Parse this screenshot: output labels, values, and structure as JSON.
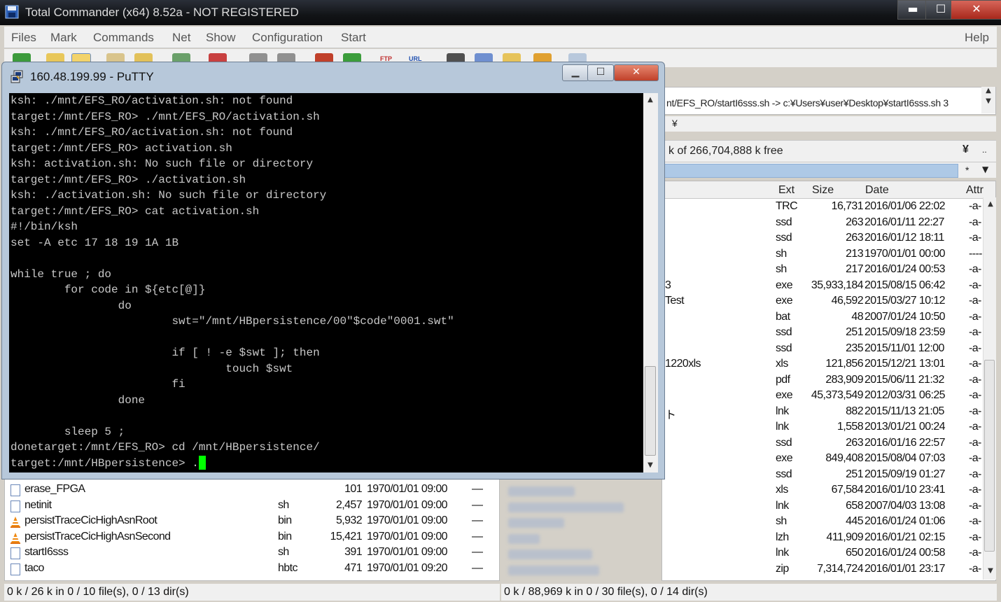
{
  "tc": {
    "title": "Total Commander (x64) 8.52a - NOT REGISTERED",
    "window_buttons": {
      "minimize": "▬",
      "maximize": "☐",
      "close": "✕"
    },
    "menu": [
      "Files",
      "Mark",
      "Commands",
      "Net",
      "Show",
      "Configuration",
      "Start"
    ],
    "menu_help": "Help",
    "toolbar": {
      "ftp": "FTP",
      "url": "URL"
    }
  },
  "right_panel": {
    "path": "nt/EFS_RO/startI6sss.sh -> c:¥Users¥user¥Desktop¥startI6sss.sh 3",
    "drive_label": "¥",
    "free_space": "k of 266,704,888 k free",
    "root_button": "¥",
    "up_button": "..",
    "star": "*",
    "dropdown": "▼",
    "headers": {
      "ext": "Ext",
      "size": "Size",
      "date": "Date",
      "attr": "Attr"
    },
    "rows": [
      {
        "name": "",
        "ext": "TRC",
        "size": "16,731",
        "date": "2016/01/06 22:02",
        "attr": "-a-"
      },
      {
        "name": "",
        "ext": "ssd",
        "size": "263",
        "date": "2016/01/11 22:27",
        "attr": "-a-"
      },
      {
        "name": "",
        "ext": "ssd",
        "size": "263",
        "date": "2016/01/12 18:11",
        "attr": "-a-"
      },
      {
        "name": "",
        "ext": "sh",
        "size": "213",
        "date": "1970/01/01 00:00",
        "attr": "----"
      },
      {
        "name": "",
        "ext": "sh",
        "size": "217",
        "date": "2016/01/24 00:53",
        "attr": "-a-"
      },
      {
        "name": "3",
        "ext": "exe",
        "size": "35,933,184",
        "date": "2015/08/15 06:42",
        "attr": "-a-"
      },
      {
        "name": "Test",
        "ext": "exe",
        "size": "46,592",
        "date": "2015/03/27 10:12",
        "attr": "-a-"
      },
      {
        "name": "",
        "ext": "bat",
        "size": "48",
        "date": "2007/01/24 10:50",
        "attr": "-a-"
      },
      {
        "name": "",
        "ext": "ssd",
        "size": "251",
        "date": "2015/09/18 23:59",
        "attr": "-a-"
      },
      {
        "name": "",
        "ext": "ssd",
        "size": "235",
        "date": "2015/11/01 12:00",
        "attr": "-a-"
      },
      {
        "name": "1220xls",
        "ext": "xls",
        "size": "121,856",
        "date": "2015/12/21 13:01",
        "attr": "-a-"
      },
      {
        "name": "",
        "ext": "pdf",
        "size": "283,909",
        "date": "2015/06/11 21:32",
        "attr": "-a-"
      },
      {
        "name": "",
        "ext": "exe",
        "size": "45,373,549",
        "date": "2012/03/31 06:25",
        "attr": "-a-"
      },
      {
        "name": "ト",
        "ext": "lnk",
        "size": "882",
        "date": "2015/11/13 21:05",
        "attr": "-a-"
      },
      {
        "name": "",
        "ext": "lnk",
        "size": "1,558",
        "date": "2013/01/21 00:24",
        "attr": "-a-"
      },
      {
        "name": "",
        "ext": "ssd",
        "size": "263",
        "date": "2016/01/16 22:57",
        "attr": "-a-"
      },
      {
        "name": "",
        "ext": "exe",
        "size": "849,408",
        "date": "2015/08/04 07:03",
        "attr": "-a-"
      },
      {
        "name": "",
        "ext": "ssd",
        "size": "251",
        "date": "2015/09/19 01:27",
        "attr": "-a-"
      },
      {
        "name": "",
        "ext": "xls",
        "size": "67,584",
        "date": "2016/01/10 23:41",
        "attr": "-a-"
      },
      {
        "name": "",
        "ext": "lnk",
        "size": "658",
        "date": "2007/04/03 13:08",
        "attr": "-a-"
      },
      {
        "name": "",
        "ext": "sh",
        "size": "445",
        "date": "2016/01/24 01:06",
        "attr": "-a-"
      },
      {
        "name": "",
        "ext": "lzh",
        "size": "411,909",
        "date": "2016/01/21 02:15",
        "attr": "-a-"
      },
      {
        "name": "",
        "ext": "lnk",
        "size": "650",
        "date": "2016/01/24 00:58",
        "attr": "-a-"
      },
      {
        "name": "",
        "ext": "zip",
        "size": "7,314,724",
        "date": "2016/01/01 23:17",
        "attr": "-a-"
      }
    ],
    "status": "0 k / 88,969 k in 0 / 30 file(s), 0 / 14 dir(s)"
  },
  "left_panel": {
    "rows": [
      {
        "icon": "file",
        "name": "erase_FPGA",
        "ext": "",
        "size": "101",
        "date": "1970/01/01 09:00",
        "attr": "—"
      },
      {
        "icon": "file",
        "name": "netinit",
        "ext": "sh",
        "size": "2,457",
        "date": "1970/01/01 09:00",
        "attr": "—"
      },
      {
        "icon": "cone",
        "name": "persistTraceCicHighAsnRoot",
        "ext": "bin",
        "size": "5,932",
        "date": "1970/01/01 09:00",
        "attr": "—"
      },
      {
        "icon": "cone",
        "name": "persistTraceCicHighAsnSecond",
        "ext": "bin",
        "size": "15,421",
        "date": "1970/01/01 09:00",
        "attr": "—"
      },
      {
        "icon": "file",
        "name": "startI6sss",
        "ext": "sh",
        "size": "391",
        "date": "1970/01/01 09:00",
        "attr": "—"
      },
      {
        "icon": "file",
        "name": "taco",
        "ext": "hbtc",
        "size": "471",
        "date": "1970/01/01 09:20",
        "attr": "—"
      }
    ],
    "status": "0 k / 26 k in 0 / 10 file(s), 0 / 13 dir(s)"
  },
  "putty": {
    "title": "160.48.199.99 - PuTTY",
    "buttons": {
      "minimize": "▁",
      "maximize": "☐",
      "close": "✕"
    },
    "lines": [
      "ksh: ./mnt/EFS_RO/activation.sh: not found",
      "target:/mnt/EFS_RO> ./mnt/EFS_RO/activation.sh",
      "ksh: ./mnt/EFS_RO/activation.sh: not found",
      "target:/mnt/EFS_RO> activation.sh",
      "ksh: activation.sh: No such file or directory",
      "target:/mnt/EFS_RO> ./activation.sh",
      "ksh: ./activation.sh: No such file or directory",
      "target:/mnt/EFS_RO> cat activation.sh",
      "#!/bin/ksh",
      "set -A etc 17 18 19 1A 1B",
      "",
      "while true ; do",
      "        for code in ${etc[@]}",
      "                do",
      "                        swt=\"/mnt/HBpersistence/00\"$code\"0001.swt\"",
      "",
      "                        if [ ! -e $swt ]; then",
      "                                touch $swt",
      "                        fi",
      "                done",
      "",
      "        sleep 5 ;",
      "donetarget:/mnt/EFS_RO> cd /mnt/HBpersistence/",
      "target:/mnt/HBpersistence> ."
    ]
  }
}
